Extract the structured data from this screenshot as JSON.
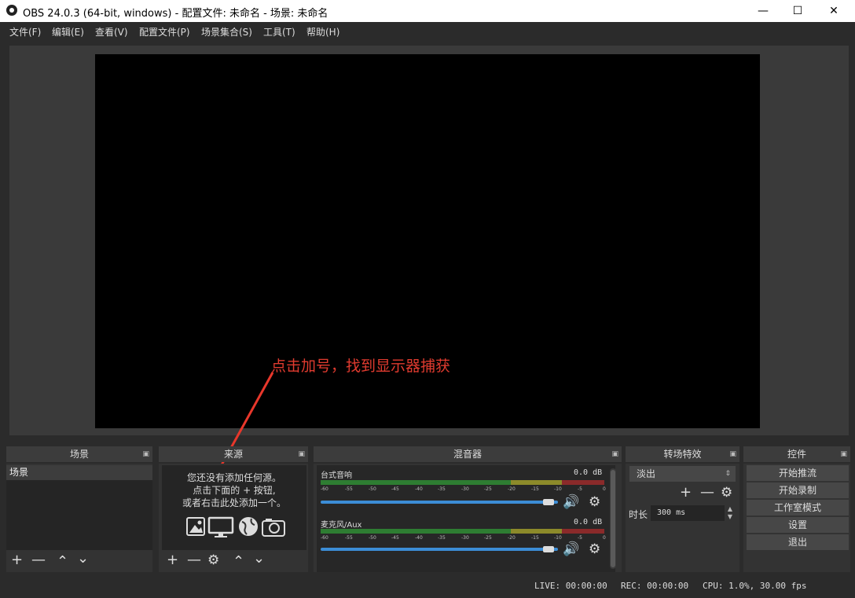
{
  "window": {
    "title": "OBS 24.0.3 (64-bit, windows) - 配置文件: 未命名 - 场景: 未命名",
    "minimize_glyph": "—",
    "maximize_glyph": "☐",
    "close_glyph": "✕"
  },
  "menu": [
    {
      "label": "文件(F)"
    },
    {
      "label": "编辑(E)"
    },
    {
      "label": "查看(V)"
    },
    {
      "label": "配置文件(P)"
    },
    {
      "label": "场景集合(S)"
    },
    {
      "label": "工具(T)"
    },
    {
      "label": "帮助(H)"
    }
  ],
  "annotation": "点击加号，找到显示器捕获",
  "scenes": {
    "header": "场景",
    "items": [
      "场景"
    ]
  },
  "sources": {
    "header": "来源",
    "empty_line1": "您还没有添加任何源。",
    "empty_line2": "点击下面的 + 按钮,",
    "empty_line3": "或者右击此处添加一个。"
  },
  "mixer": {
    "header": "混音器",
    "scale": [
      "-60",
      "-55",
      "-50",
      "-45",
      "-40",
      "-35",
      "-30",
      "-25",
      "-20",
      "-15",
      "-10",
      "-5",
      "0"
    ],
    "channels": [
      {
        "name": "台式音响",
        "db": "0.0 dB",
        "volume_fraction": 0.97
      },
      {
        "name": "麦克风/Aux",
        "db": "0.0 dB",
        "volume_fraction": 0.97
      }
    ]
  },
  "transitions": {
    "header": "转场特效",
    "selected": "淡出",
    "duration_label": "时长",
    "duration_value": "300 ms"
  },
  "controls": {
    "header": "控件",
    "buttons": [
      "开始推流",
      "开始录制",
      "工作室模式",
      "设置",
      "退出"
    ]
  },
  "status": {
    "live": "LIVE: 00:00:00",
    "rec": "REC: 00:00:00",
    "cpu": "CPU: 1.0%, 30.00 fps"
  },
  "icons": {
    "add": "+",
    "remove": "—",
    "up": "⌃",
    "down": "⌄",
    "gear": "⚙",
    "speaker": "🔊"
  }
}
